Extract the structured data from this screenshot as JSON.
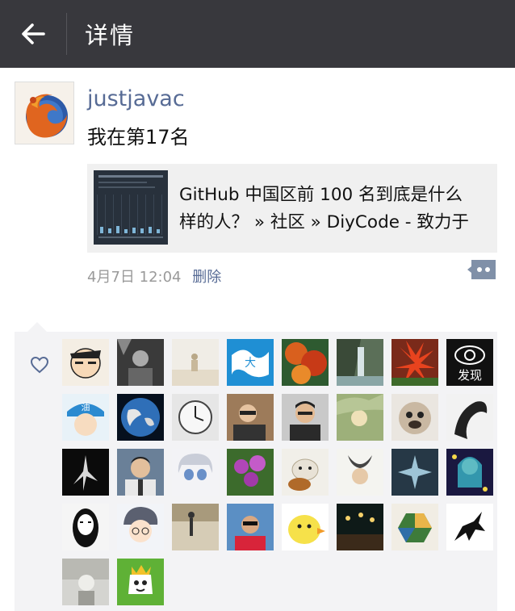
{
  "header": {
    "title": "详情",
    "back_icon": "arrow-left-icon"
  },
  "post": {
    "username": "justjavac",
    "text": "我在第17名",
    "link": {
      "title_line1": "GitHub 中国区前 100 名到底是什么",
      "title_line2": "样的人？ » 社区 » DiyCode - 致力于"
    },
    "time": "4月7日 12:04",
    "delete_label": "删除"
  },
  "likes": {
    "heart_icon": "heart-icon",
    "faxian_label": "发现",
    "avatar_count": 34
  },
  "colors": {
    "topbar": "#38383d",
    "link_blue": "#576b95",
    "likes_bg": "#f3f3f5"
  }
}
